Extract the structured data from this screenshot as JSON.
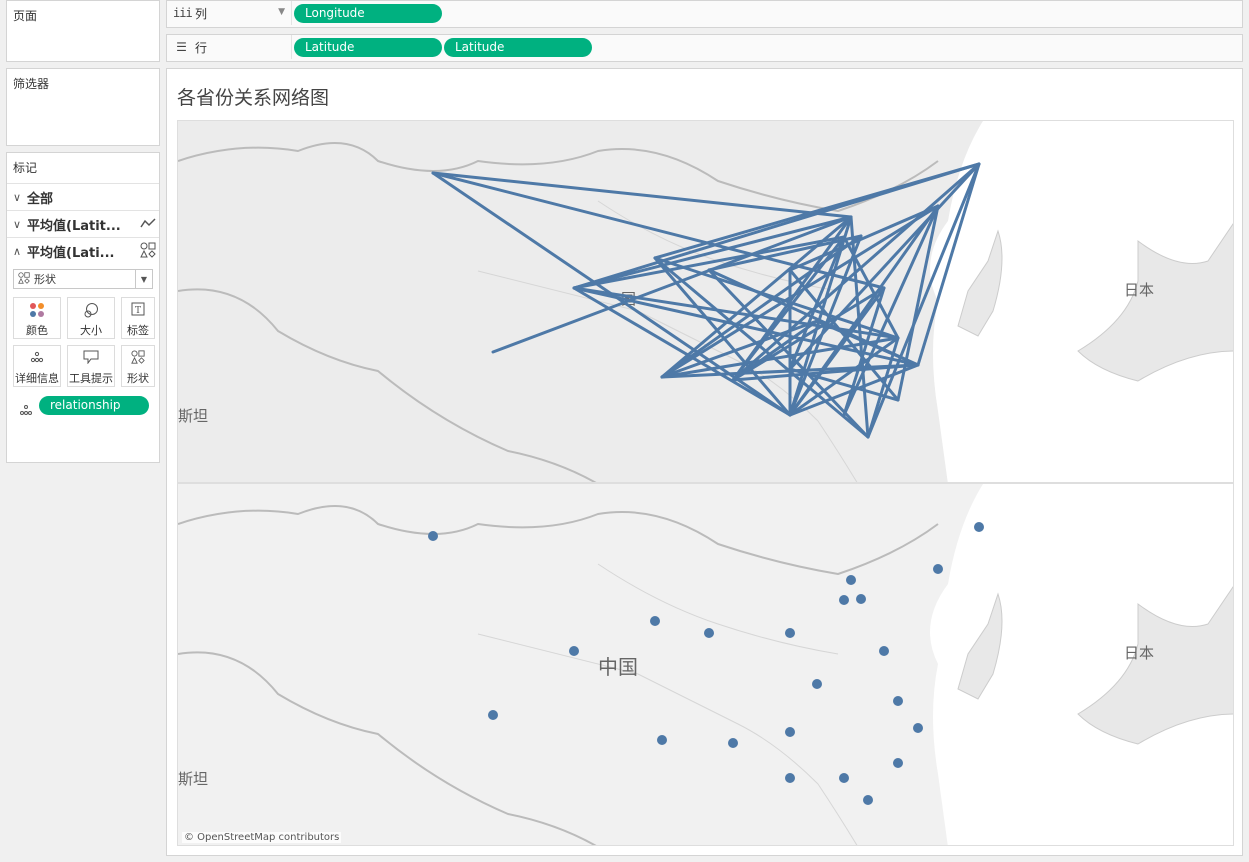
{
  "left_pane": {
    "pages_title": "页面",
    "filters_title": "筛选器",
    "marks": {
      "title": "标记",
      "rows": [
        {
          "label": "全部",
          "expanded": false
        },
        {
          "label": "平均值(Latit...",
          "expanded": false,
          "icon": "line-icon"
        },
        {
          "label": "平均值(Lati...",
          "expanded": true,
          "icon": "shape-icon"
        }
      ],
      "mark_type": "形状",
      "buttons": [
        {
          "label": "颜色",
          "icon": "color-icon"
        },
        {
          "label": "大小",
          "icon": "size-icon"
        },
        {
          "label": "标签",
          "icon": "label-icon"
        },
        {
          "label": "详细信息",
          "icon": "detail-icon"
        },
        {
          "label": "工具提示",
          "icon": "tooltip-icon"
        },
        {
          "label": "形状",
          "icon": "shape-icon"
        }
      ],
      "field_pill": "relationship"
    }
  },
  "shelves": {
    "columns": {
      "label": "列",
      "pills": [
        "Longitude"
      ]
    },
    "rows": {
      "label": "行",
      "pills": [
        "Latitude",
        "Latitude"
      ]
    }
  },
  "view": {
    "title": "各省份关系网络图",
    "map_labels": {
      "china_top": "国",
      "china": "中国",
      "japan": "日本",
      "stan": "斯坦"
    },
    "attribution": "© OpenStreetMap contributors",
    "accent_color": "#4e79a7",
    "pill_color": "#00b180"
  }
}
